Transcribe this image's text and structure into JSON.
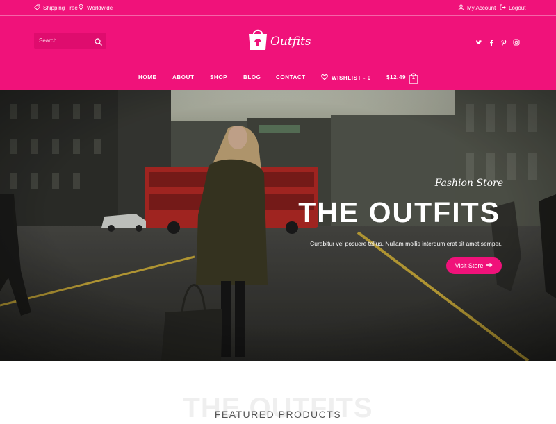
{
  "topbar": {
    "shipping": "Shipping Free",
    "worldwide": "Worldwide",
    "account": "My Account",
    "logout": "Logout"
  },
  "header": {
    "search_placeholder": "Search...",
    "logo_text": "Outfits",
    "social_icons": [
      "twitter-icon",
      "facebook-icon",
      "pinterest-icon",
      "instagram-icon"
    ]
  },
  "nav": {
    "items": [
      "HOME",
      "ABOUT",
      "SHOP",
      "BLOG",
      "CONTACT"
    ],
    "wishlist": "WISHLIST - 0",
    "cart_total": "$12.49",
    "cart_count": "1"
  },
  "hero": {
    "script": "Fashion Store",
    "title": "THE OUTFITS",
    "subtitle": "Curabitur vel posuere tellus. Nullam mollis interdum erat sit amet semper.",
    "button": "Visit Store"
  },
  "section": {
    "watermark": "THE OUTFITS",
    "title": "FEATURED PRODUCTS"
  },
  "colors": {
    "brand_pink": "#f0127a",
    "search_bg": "#df0c6e"
  }
}
